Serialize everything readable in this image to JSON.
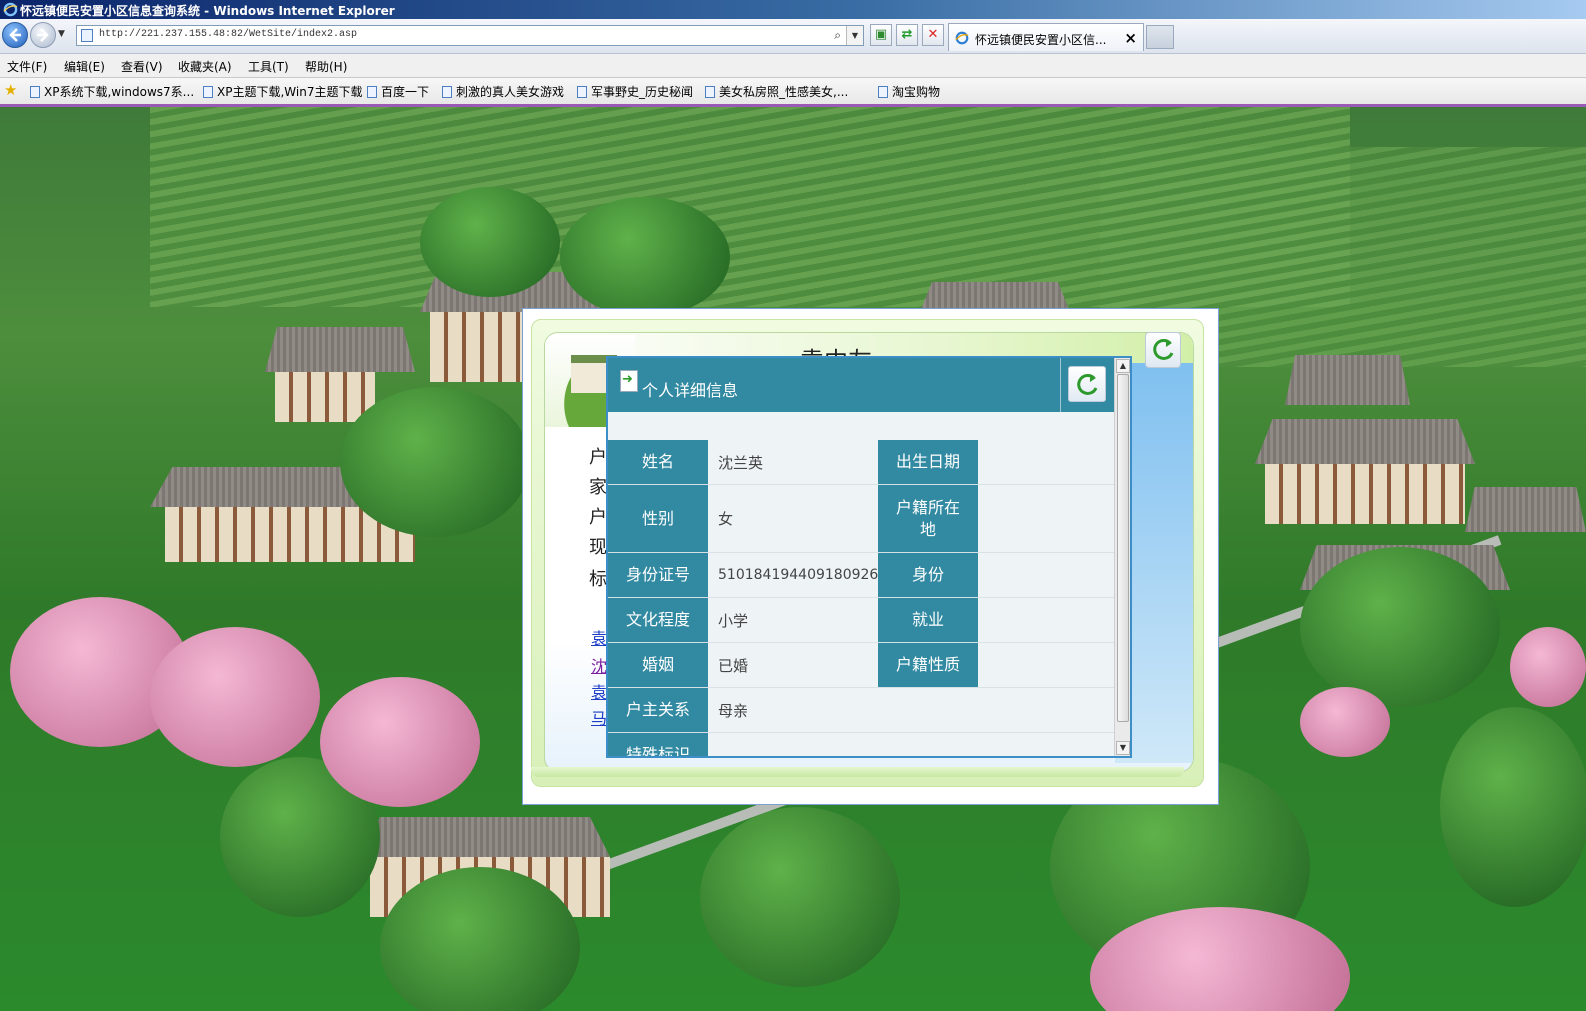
{
  "window": {
    "title": "怀远镇便民安置小区信息查询系统 - Windows Internet Explorer"
  },
  "address": {
    "url": "http://221.237.155.48:82/WetSite/index2.asp"
  },
  "tab": {
    "label": "怀远镇便民安置小区信..."
  },
  "menu": [
    "文件(F)",
    "编辑(E)",
    "查看(V)",
    "收藏夹(A)",
    "工具(T)",
    "帮助(H)"
  ],
  "favorites": [
    "XP系统下载,windows7系...",
    "XP主题下载,Win7主题下载",
    "百度一下",
    "刺激的真人美女游戏",
    "军事野史_历史秘闻",
    "美女私房照_性感美女,...",
    "淘宝购物"
  ],
  "outer": {
    "title": "袁中友",
    "side_chars": [
      "户",
      "家",
      "户",
      "现",
      "标"
    ],
    "links": [
      "袁",
      "沈",
      "袁",
      "马"
    ]
  },
  "detail": {
    "title": "个人详细信息",
    "fields": {
      "name_label": "姓名",
      "name_value": "沈兰英",
      "dob_label": "出生日期",
      "dob_value": "",
      "gender_label": "性别",
      "gender_value": "女",
      "hukou_loc_label": "户籍所在地",
      "hukou_loc_value": "",
      "id_label": "身份证号",
      "id_value": "510184194409180926",
      "identity_label": "身份",
      "identity_value": "",
      "edu_label": "文化程度",
      "edu_value": "小学",
      "job_label": "就业",
      "job_value": "",
      "marriage_label": "婚姻",
      "marriage_value": "已婚",
      "hukou_type_label": "户籍性质",
      "hukou_type_value": "",
      "relation_label": "户主关系",
      "relation_value": "母亲",
      "special_label": "特殊标识",
      "special_value": ""
    }
  },
  "colors": {
    "header_teal": "#328aa2",
    "row_bg": "#eef4f6",
    "link": "#1a3cc7",
    "visited": "#7b1fa2"
  }
}
